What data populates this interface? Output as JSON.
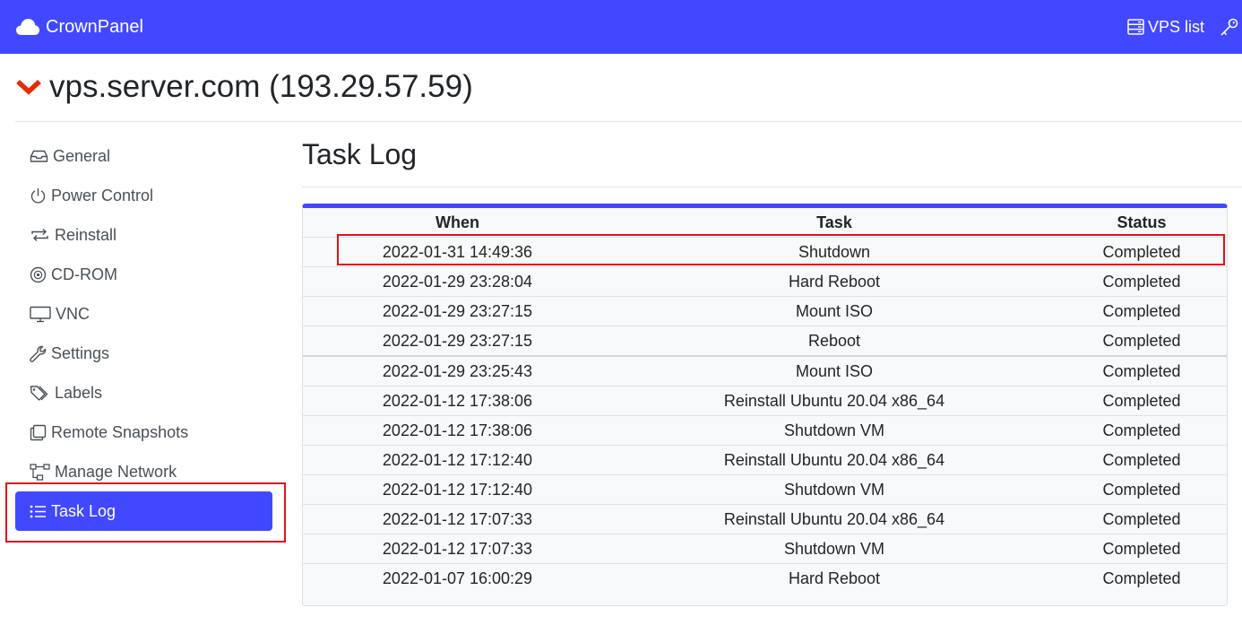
{
  "navbar": {
    "brand": "CrownPanel",
    "vps_list_label": "VPS list",
    "icons": [
      "cloud-icon",
      "server-list-icon",
      "key-icon"
    ]
  },
  "server": {
    "title": "vps.server.com (193.29.57.59)",
    "chevron_color": "#e62c00"
  },
  "sidebar": {
    "items": [
      {
        "label": "General",
        "icon": "inbox-icon",
        "active": false
      },
      {
        "label": "Power Control",
        "icon": "power-icon",
        "active": false
      },
      {
        "label": "Reinstall",
        "icon": "repeat-icon",
        "active": false
      },
      {
        "label": "CD-ROM",
        "icon": "disc-icon",
        "active": false
      },
      {
        "label": "VNC",
        "icon": "monitor-icon",
        "active": false
      },
      {
        "label": "Settings",
        "icon": "wrench-icon",
        "active": false
      },
      {
        "label": "Labels",
        "icon": "tags-icon",
        "active": false
      },
      {
        "label": "Remote Snapshots",
        "icon": "copy-icon",
        "active": false
      },
      {
        "label": "Manage Network",
        "icon": "network-icon",
        "active": false
      },
      {
        "label": "Task Log",
        "icon": "list-icon",
        "active": true
      }
    ]
  },
  "main": {
    "title": "Task Log",
    "table": {
      "headers": [
        "When",
        "Task",
        "Status"
      ],
      "rows": [
        {
          "when": "2022-01-31 14:49:36",
          "task": "Shutdown",
          "status": "Completed"
        },
        {
          "when": "2022-01-29 23:28:04",
          "task": "Hard Reboot",
          "status": "Completed"
        },
        {
          "when": "2022-01-29 23:27:15",
          "task": "Mount ISO",
          "status": "Completed"
        },
        {
          "when": "2022-01-29 23:27:15",
          "task": "Reboot",
          "status": "Completed"
        },
        {
          "when": "2022-01-29 23:25:43",
          "task": "Mount ISO",
          "status": "Completed"
        },
        {
          "when": "2022-01-12 17:38:06",
          "task": "Reinstall Ubuntu 20.04 x86_64",
          "status": "Completed"
        },
        {
          "when": "2022-01-12 17:38:06",
          "task": "Shutdown VM",
          "status": "Completed"
        },
        {
          "when": "2022-01-12 17:12:40",
          "task": "Reinstall Ubuntu 20.04 x86_64",
          "status": "Completed"
        },
        {
          "when": "2022-01-12 17:12:40",
          "task": "Shutdown VM",
          "status": "Completed"
        },
        {
          "when": "2022-01-12 17:07:33",
          "task": "Reinstall Ubuntu 20.04 x86_64",
          "status": "Completed"
        },
        {
          "when": "2022-01-12 17:07:33",
          "task": "Shutdown VM",
          "status": "Completed"
        },
        {
          "when": "2022-01-07 16:00:29",
          "task": "Hard Reboot",
          "status": "Completed"
        }
      ]
    }
  },
  "colors": {
    "accent": "#4148ff",
    "highlight_box": "#e0111a"
  }
}
